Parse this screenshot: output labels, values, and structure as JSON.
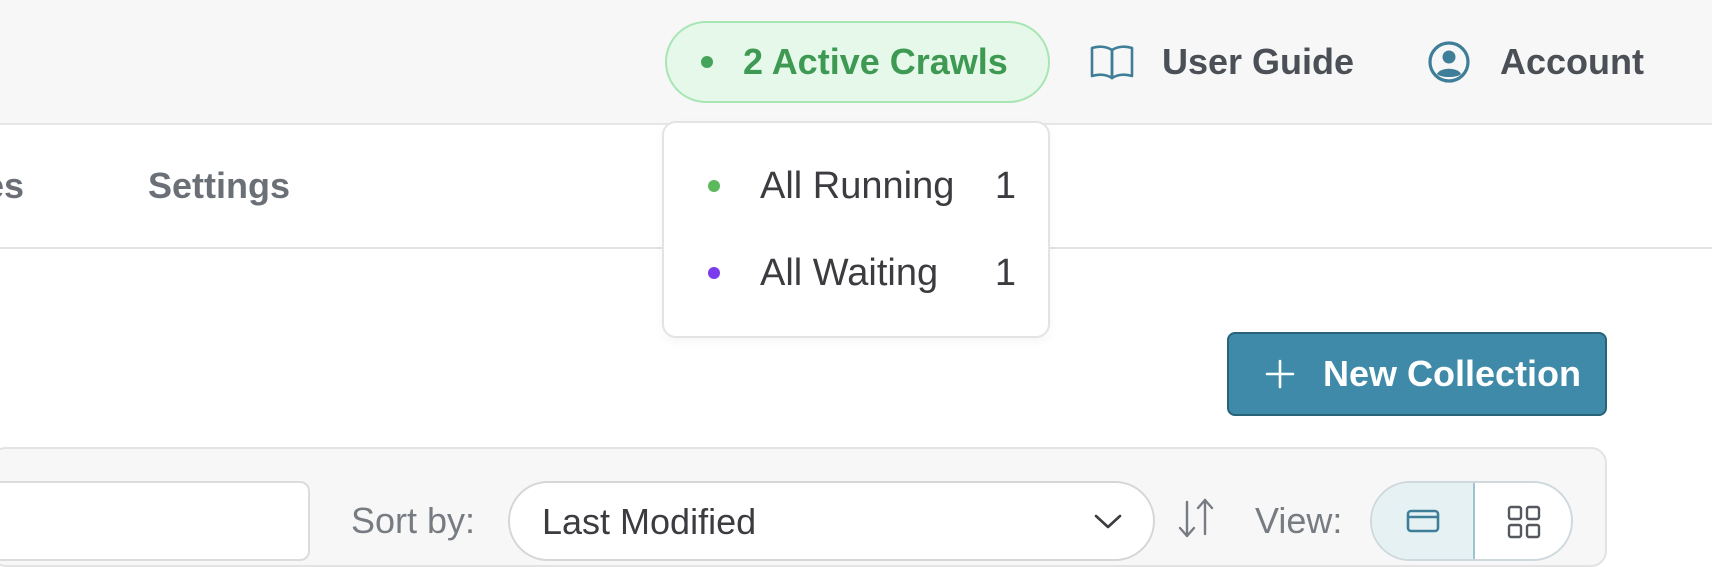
{
  "header": {
    "active_crawls_label": "2 Active Crawls",
    "user_guide_label": "User Guide",
    "account_label": "Account",
    "icons": {
      "guide": "book-icon",
      "account": "user-circle-icon"
    }
  },
  "tabs": {
    "profiles_label": "ofiles",
    "settings_label": "Settings"
  },
  "crawls_dropdown": {
    "items": [
      {
        "label": "All Running",
        "count": "1",
        "color": "#5cb85c"
      },
      {
        "label": "All Waiting",
        "count": "1",
        "color": "#7c3aed"
      }
    ]
  },
  "actions": {
    "new_collection_label": "New Collection"
  },
  "toolbar": {
    "sort_label": "Sort by:",
    "sort_value": "Last Modified",
    "view_label": "View:"
  },
  "colors": {
    "accent": "#3e8aa8",
    "active_green": "#3e9a53",
    "pill_background": "#e6f8ea"
  }
}
